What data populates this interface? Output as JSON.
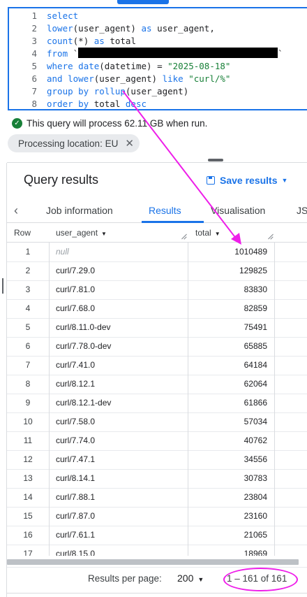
{
  "editor": {
    "lines": [
      {
        "n": "1",
        "segments": [
          {
            "t": "select",
            "c": "kw"
          }
        ]
      },
      {
        "n": "2",
        "segments": [
          {
            "t": "lower",
            "c": "kw"
          },
          {
            "t": "(user_agent) ",
            "c": ""
          },
          {
            "t": "as",
            "c": "kw"
          },
          {
            "t": " user_agent,",
            "c": ""
          }
        ]
      },
      {
        "n": "3",
        "segments": [
          {
            "t": "count",
            "c": "kw"
          },
          {
            "t": "(*) ",
            "c": ""
          },
          {
            "t": "as",
            "c": "kw"
          },
          {
            "t": " total",
            "c": ""
          }
        ]
      },
      {
        "n": "4",
        "segments": [
          {
            "t": "from",
            "c": "kw"
          },
          {
            "t": " `",
            "c": ""
          },
          {
            "t": "",
            "c": "redact"
          },
          {
            "t": "`",
            "c": ""
          }
        ]
      },
      {
        "n": "5",
        "segments": [
          {
            "t": "where",
            "c": "kw"
          },
          {
            "t": " ",
            "c": ""
          },
          {
            "t": "date",
            "c": "kw"
          },
          {
            "t": "(datetime) = ",
            "c": ""
          },
          {
            "t": "\"2025-08-18\"",
            "c": "str"
          }
        ]
      },
      {
        "n": "6",
        "segments": [
          {
            "t": "and",
            "c": "kw"
          },
          {
            "t": " ",
            "c": ""
          },
          {
            "t": "lower",
            "c": "kw"
          },
          {
            "t": "(user_agent) ",
            "c": ""
          },
          {
            "t": "like",
            "c": "kw"
          },
          {
            "t": " ",
            "c": ""
          },
          {
            "t": "\"curl/%\"",
            "c": "str"
          }
        ]
      },
      {
        "n": "7",
        "segments": [
          {
            "t": "group by",
            "c": "kw"
          },
          {
            "t": " ",
            "c": ""
          },
          {
            "t": "rollup",
            "c": "kw"
          },
          {
            "t": "(user_agent)",
            "c": ""
          }
        ]
      },
      {
        "n": "8",
        "segments": [
          {
            "t": "order by",
            "c": "kw"
          },
          {
            "t": " total ",
            "c": ""
          },
          {
            "t": "desc",
            "c": "kw"
          }
        ]
      }
    ]
  },
  "validation": {
    "message": "This query will process 62.11 GB when run."
  },
  "location_chip": {
    "label": "Processing location: EU",
    "close": "✕"
  },
  "results": {
    "title": "Query results",
    "save_label": "Save results",
    "tabs": [
      {
        "label": "Job information",
        "active": false
      },
      {
        "label": "Results",
        "active": true
      },
      {
        "label": "Visualisation",
        "active": false
      },
      {
        "label": "JS",
        "active": false
      }
    ],
    "columns": {
      "row": "Row",
      "user_agent": "user_agent",
      "total": "total"
    },
    "rows": [
      {
        "row": "1",
        "user_agent": "null",
        "total": "1010489",
        "is_null": true
      },
      {
        "row": "2",
        "user_agent": "curl/7.29.0",
        "total": "129825"
      },
      {
        "row": "3",
        "user_agent": "curl/7.81.0",
        "total": "83830"
      },
      {
        "row": "4",
        "user_agent": "curl/7.68.0",
        "total": "82859"
      },
      {
        "row": "5",
        "user_agent": "curl/8.11.0-dev",
        "total": "75491"
      },
      {
        "row": "6",
        "user_agent": "curl/7.78.0-dev",
        "total": "65885"
      },
      {
        "row": "7",
        "user_agent": "curl/7.41.0",
        "total": "64184"
      },
      {
        "row": "8",
        "user_agent": "curl/8.12.1",
        "total": "62064"
      },
      {
        "row": "9",
        "user_agent": "curl/8.12.1-dev",
        "total": "61866"
      },
      {
        "row": "10",
        "user_agent": "curl/7.58.0",
        "total": "57034"
      },
      {
        "row": "11",
        "user_agent": "curl/7.74.0",
        "total": "40762"
      },
      {
        "row": "12",
        "user_agent": "curl/7.47.1",
        "total": "34556"
      },
      {
        "row": "13",
        "user_agent": "curl/8.14.1",
        "total": "30783"
      },
      {
        "row": "14",
        "user_agent": "curl/7.88.1",
        "total": "23804"
      },
      {
        "row": "15",
        "user_agent": "curl/7.87.0",
        "total": "23160"
      },
      {
        "row": "16",
        "user_agent": "curl/7.61.1",
        "total": "21065"
      },
      {
        "row": "17",
        "user_agent": "curl/8.15.0",
        "total": "18969"
      }
    ]
  },
  "footer": {
    "rows_per_page_label": "Results per page:",
    "rows_per_page_value": "200",
    "pagination": "1 – 161 of 161"
  },
  "annotation_color": "#ee1ee9"
}
